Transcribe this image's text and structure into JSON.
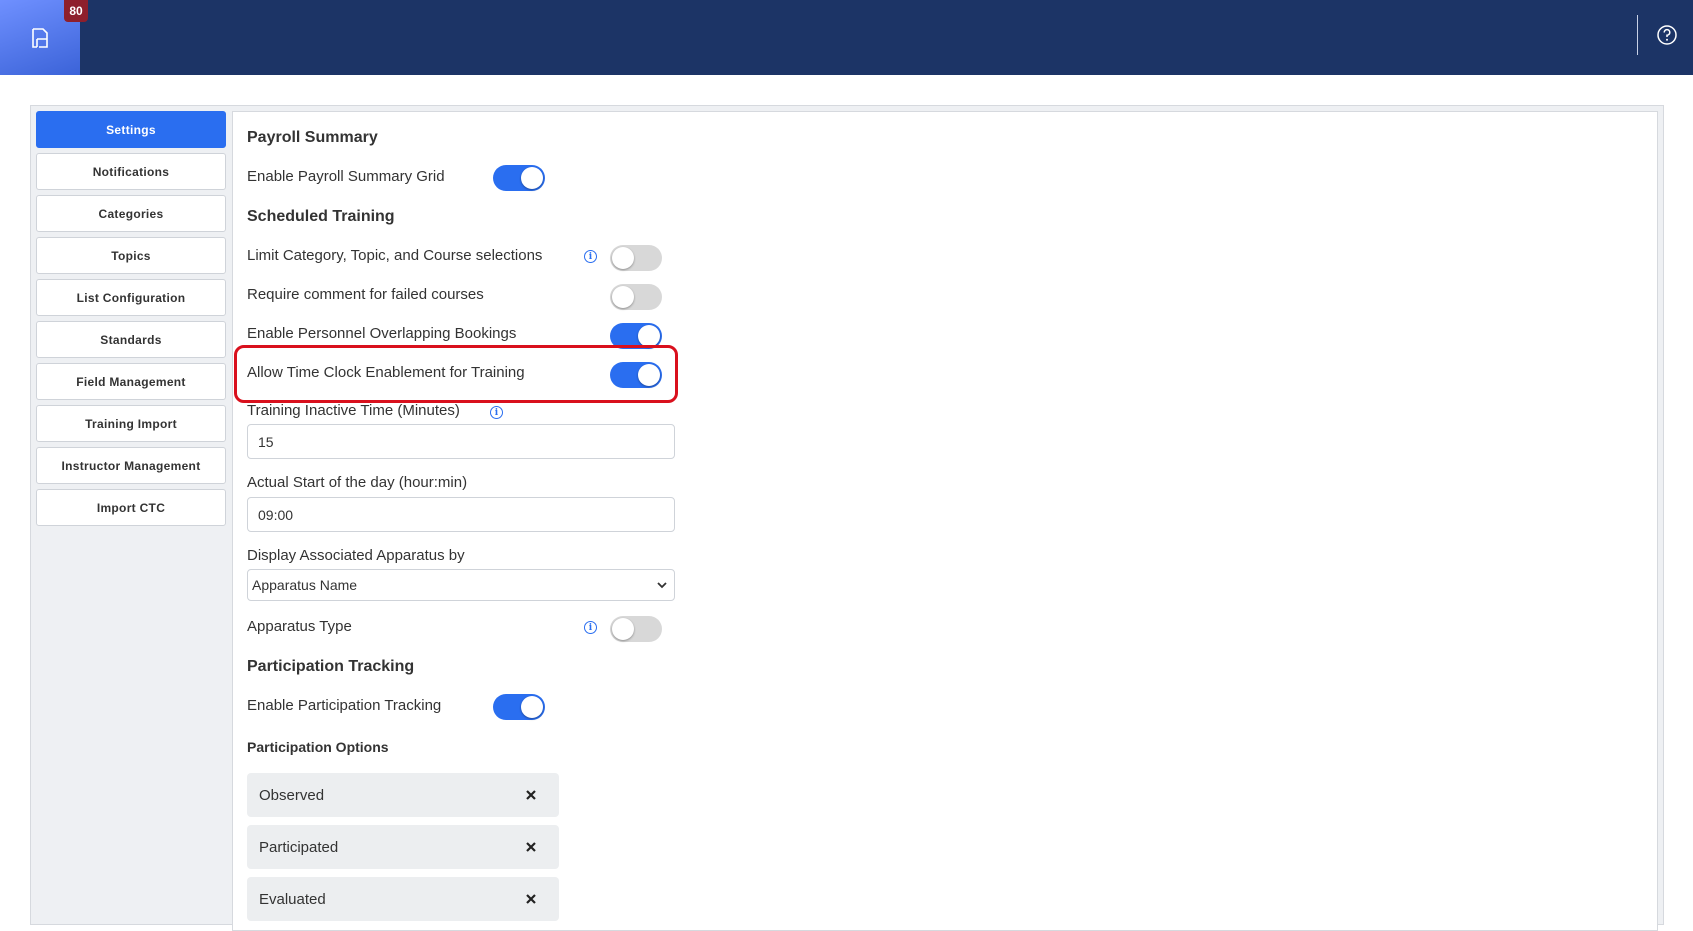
{
  "header": {
    "badge_count": "80",
    "logo_icon": "document-icon",
    "help_icon": "help-circle-icon",
    "background": "#1c3466"
  },
  "sidebar": {
    "items": [
      {
        "label": "Settings",
        "active": true
      },
      {
        "label": "Notifications",
        "active": false
      },
      {
        "label": "Categories",
        "active": false
      },
      {
        "label": "Topics",
        "active": false
      },
      {
        "label": "List Configuration",
        "active": false
      },
      {
        "label": "Standards",
        "active": false
      },
      {
        "label": "Field Management",
        "active": false
      },
      {
        "label": "Training Import",
        "active": false
      },
      {
        "label": "Instructor Management",
        "active": false
      },
      {
        "label": "Import CTC",
        "active": false
      }
    ],
    "accent": "#2a6ef0"
  },
  "settings": {
    "payroll_summary_title": "Payroll Summary",
    "enable_payroll_summary_grid": {
      "label": "Enable Payroll Summary Grid",
      "on": true
    },
    "scheduled_training_title": "Scheduled Training",
    "limit_selections": {
      "label": "Limit Category, Topic, and Course selections",
      "on": false
    },
    "require_comment": {
      "label": "Require comment for failed courses",
      "on": false
    },
    "overlapping_bookings": {
      "label": "Enable Personnel Overlapping Bookings",
      "on": true
    },
    "time_clock": {
      "label": "Allow Time Clock Enablement for Training",
      "on": true
    },
    "inactive_time": {
      "label": "Training Inactive Time (Minutes)",
      "value": "15"
    },
    "start_of_day": {
      "label": "Actual Start of the day (hour:min)",
      "value": "09:00"
    },
    "apparatus_display": {
      "label": "Display Associated Apparatus by",
      "value": "Apparatus Name"
    },
    "apparatus_type": {
      "label": "Apparatus Type",
      "on": false
    },
    "participation_tracking_title": "Participation Tracking",
    "enable_participation_tracking": {
      "label": "Enable Participation Tracking",
      "on": true
    },
    "participation_options_title": "Participation Options",
    "participation_options": [
      "Observed",
      "Participated",
      "Evaluated"
    ]
  },
  "colors": {
    "toggle_on": "#2a6ef0",
    "toggle_off": "#d8d8d8",
    "highlight": "#d9101d"
  }
}
